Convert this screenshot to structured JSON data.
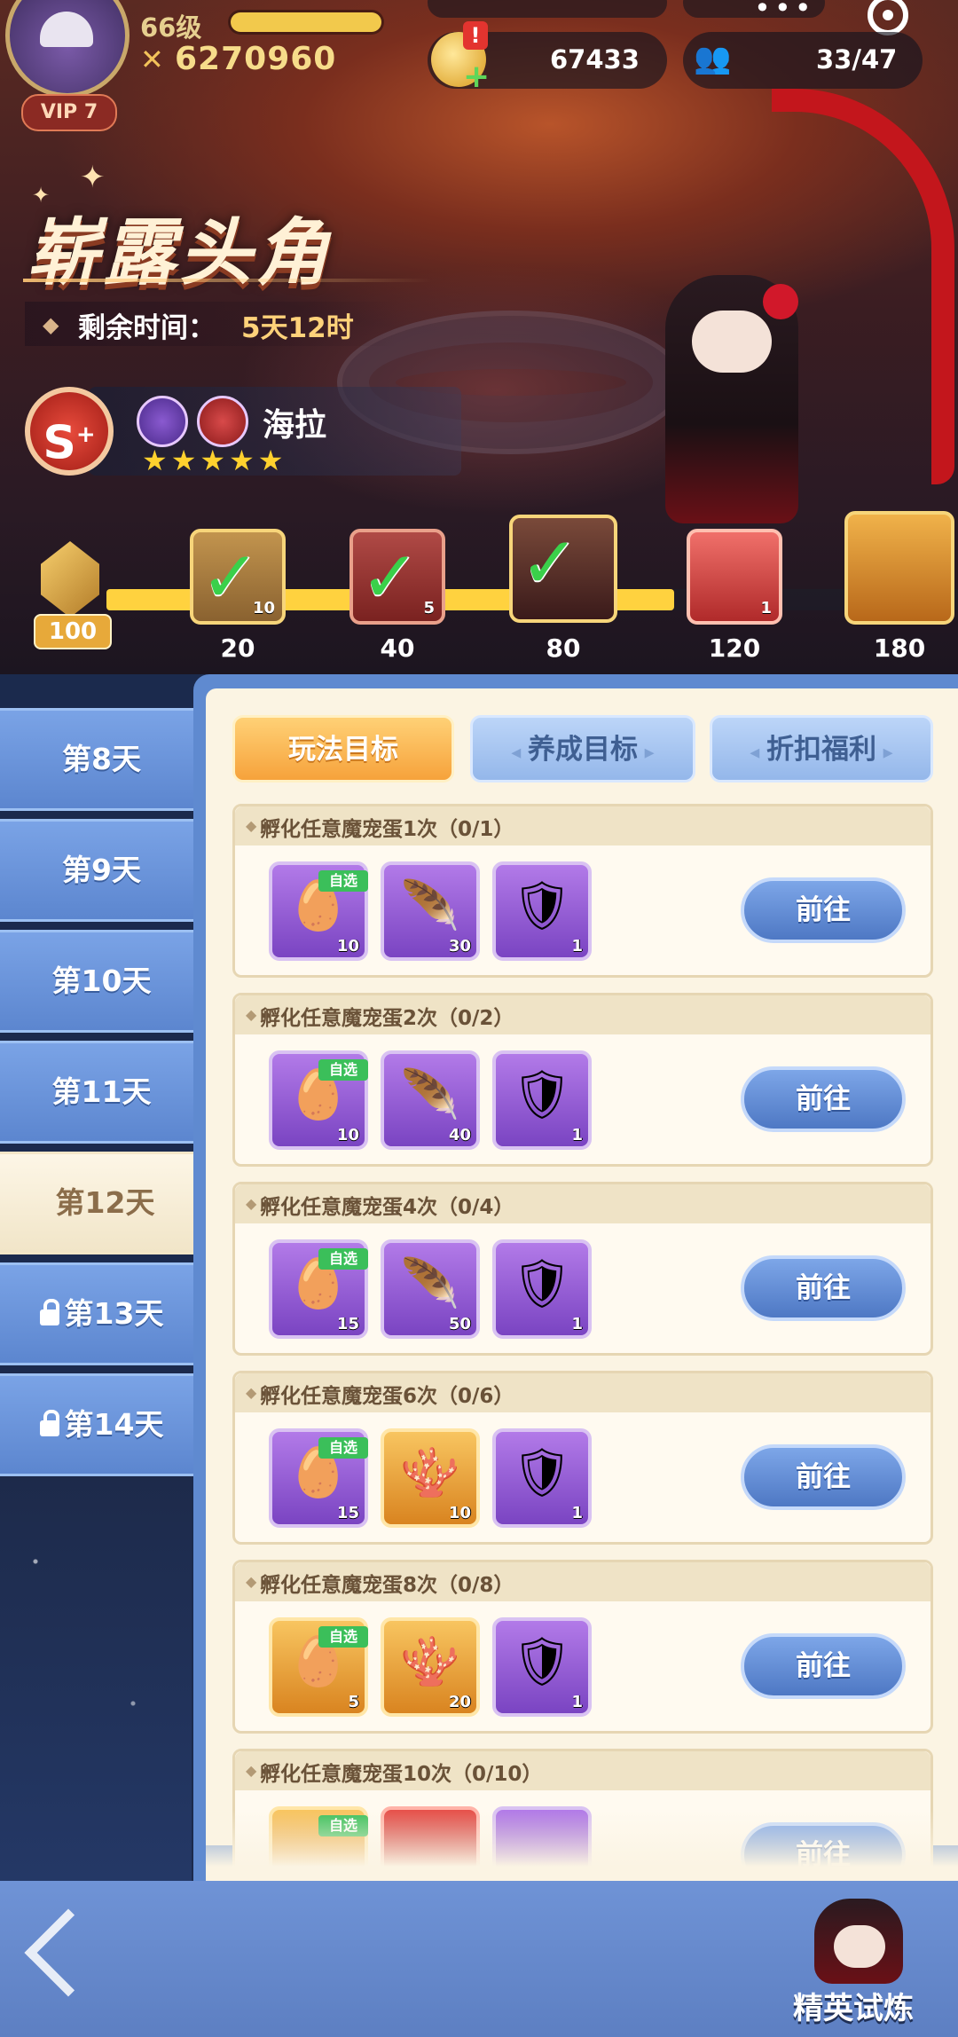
{
  "player": {
    "level": "66级",
    "power": "6270960",
    "vip": "VIP 7",
    "coins": "67433",
    "team": "33/47"
  },
  "event": {
    "title": "崭露头角",
    "timer_label": "剩余时间：",
    "timer_value": "5天12时"
  },
  "hero": {
    "grade": "S",
    "grade_plus": "+",
    "name": "海拉",
    "stars": "★★★★★"
  },
  "milestones": {
    "start_value": "100",
    "items": [
      {
        "label": "20",
        "count": "10",
        "claimed": true
      },
      {
        "label": "40",
        "count": "5",
        "claimed": true
      },
      {
        "label": "80",
        "count": "",
        "claimed": true
      },
      {
        "label": "120",
        "count": "1",
        "claimed": false
      },
      {
        "label": "180",
        "count": "",
        "claimed": false
      }
    ]
  },
  "days": [
    "第8天",
    "第9天",
    "第10天",
    "第11天",
    "第12天",
    "第13天",
    "第14天"
  ],
  "tabs": [
    "玩法目标",
    "养成目标",
    "折扣福利"
  ],
  "go_label": "前往",
  "select_tag": "自选",
  "tasks": [
    {
      "title": "孵化任意魔宠蛋1次（0/1）",
      "items": [
        "10",
        "30",
        "1"
      ]
    },
    {
      "title": "孵化任意魔宠蛋2次（0/2）",
      "items": [
        "10",
        "40",
        "1"
      ]
    },
    {
      "title": "孵化任意魔宠蛋4次（0/4）",
      "items": [
        "15",
        "50",
        "1"
      ]
    },
    {
      "title": "孵化任意魔宠蛋6次（0/6）",
      "items": [
        "15",
        "10",
        "1"
      ]
    },
    {
      "title": "孵化任意魔宠蛋8次（0/8）",
      "items": [
        "5",
        "20",
        "1"
      ]
    },
    {
      "title": "孵化任意魔宠蛋10次（0/10）",
      "items": [
        "",
        "",
        ""
      ]
    }
  ],
  "bottom": {
    "elite_label": "精英试炼"
  }
}
